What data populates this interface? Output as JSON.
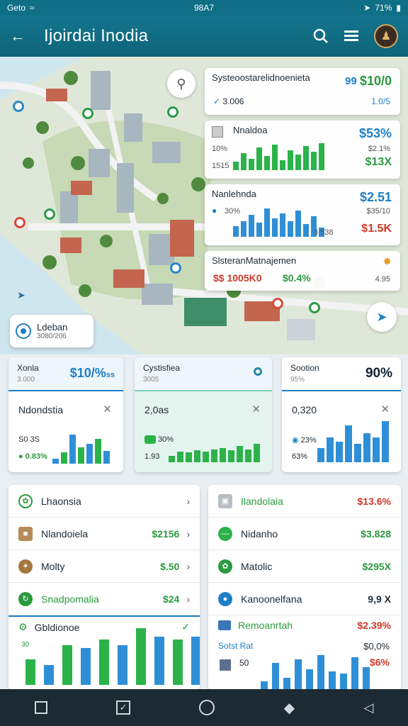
{
  "status": {
    "carrier": "Geto",
    "time": "98A7",
    "battery": "71%"
  },
  "header": {
    "title": "Ijoirdai Inodia"
  },
  "colors": {
    "primary": "#0f6f86",
    "accent": "#1f7fc4",
    "positive": "#2b9a3f",
    "negative": "#cf3a2b"
  },
  "overlay_cards": [
    {
      "title": "Systeoostarelidnoenieta",
      "value": "$10/0",
      "value_prefix": "99",
      "sub": "3.006",
      "sub_right": "1.0/5"
    },
    {
      "title": "Nnaldoa",
      "value": "$53%",
      "small_a": "10%",
      "small_b": "1515",
      "sub_right1": "$2.1%",
      "sub_right2": "$13X",
      "bars": [
        0.3,
        0.6,
        0.4,
        0.8,
        0.5,
        0.9,
        0.35,
        0.7,
        0.55,
        0.85,
        0.65,
        0.95
      ]
    },
    {
      "title": "Nanlehnda",
      "value": "$2.51",
      "small_a": "30%",
      "sub_right1": "$35/10",
      "sub_right2": "$1.5K",
      "sub_mid": "3.538",
      "bars": [
        0.35,
        0.5,
        0.7,
        0.45,
        0.9,
        0.6,
        0.75,
        0.5,
        0.85,
        0.4,
        0.65,
        0.3
      ]
    },
    {
      "title": "SlsteranMatnajemen",
      "value_a": "$$ 1005K0",
      "value_b": "$0.4%",
      "sub_right": "4.95"
    }
  ],
  "location": {
    "name": "Ldeban",
    "sub": "3080/206"
  },
  "stat_cards": [
    {
      "name": "Xonla",
      "sub": "3.000",
      "value": "$10/%",
      "value_suffix": "ss",
      "label": "Ndondstia",
      "l1": "S0 3S",
      "l2": "0.83%",
      "bars": [
        0.15,
        0.35,
        0.9,
        0.5,
        0.6,
        0.75,
        0.4
      ]
    },
    {
      "name": "Cystisfiea",
      "sub": "3005",
      "value": "",
      "label": "2,0as",
      "l1": "30%",
      "l2": "1.93",
      "bars": [
        0.3,
        0.5,
        0.45,
        0.55,
        0.5,
        0.6,
        0.65,
        0.55,
        0.75,
        0.6,
        0.85
      ]
    },
    {
      "name": "Sootion",
      "sub": "95%",
      "value": "90%",
      "label": "0,320",
      "l1": "23%",
      "l2": "63%",
      "bars": [
        0.35,
        0.6,
        0.5,
        0.9,
        0.45,
        0.7,
        0.6,
        1.0
      ]
    }
  ],
  "list_left": {
    "rows": [
      {
        "label": "Lhaonsia",
        "value": ""
      },
      {
        "label": "Nlandoiela",
        "value": "$2156"
      },
      {
        "label": "Molty",
        "value": "$.50"
      },
      {
        "label": "Snadpomalia",
        "value": "$24"
      }
    ],
    "chart_label": "Gbldionoe",
    "chart_sub": "30",
    "bars": [
      0.45,
      0.35,
      0.7,
      0.65,
      0.8,
      0.7,
      1.0,
      0.85,
      0.8,
      0.85
    ]
  },
  "list_right": {
    "rows": [
      {
        "label": "Ilandolaia",
        "value": "$13.6%"
      },
      {
        "label": "Nidanho",
        "value": "$3.828"
      },
      {
        "label": "Matolic",
        "value": "$295X"
      },
      {
        "label": "Kanoonelfana",
        "value": "9,9 X"
      }
    ],
    "chart_label": "Remoanrtah",
    "chart_value": "$2.39%",
    "chart_sub": "Sotst Rat",
    "chart_sub_val": "$0,0%",
    "chart_sub2": "$6%",
    "chart_small": "50",
    "bars": [
      0.25,
      0.7,
      0.35,
      0.8,
      0.55,
      0.9,
      0.5,
      0.45,
      0.85,
      0.6
    ]
  }
}
